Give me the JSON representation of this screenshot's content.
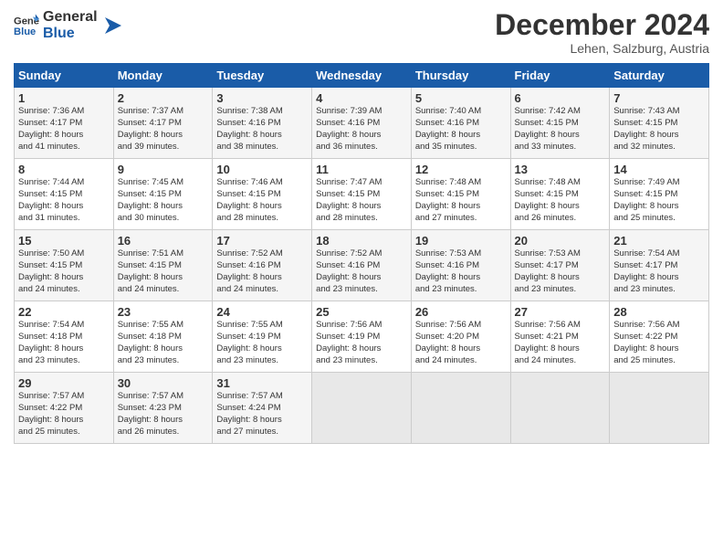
{
  "header": {
    "logo_line1": "General",
    "logo_line2": "Blue",
    "month": "December 2024",
    "location": "Lehen, Salzburg, Austria"
  },
  "columns": [
    "Sunday",
    "Monday",
    "Tuesday",
    "Wednesday",
    "Thursday",
    "Friday",
    "Saturday"
  ],
  "weeks": [
    [
      {
        "day": "1",
        "lines": [
          "Sunrise: 7:36 AM",
          "Sunset: 4:17 PM",
          "Daylight: 8 hours",
          "and 41 minutes."
        ]
      },
      {
        "day": "2",
        "lines": [
          "Sunrise: 7:37 AM",
          "Sunset: 4:17 PM",
          "Daylight: 8 hours",
          "and 39 minutes."
        ]
      },
      {
        "day": "3",
        "lines": [
          "Sunrise: 7:38 AM",
          "Sunset: 4:16 PM",
          "Daylight: 8 hours",
          "and 38 minutes."
        ]
      },
      {
        "day": "4",
        "lines": [
          "Sunrise: 7:39 AM",
          "Sunset: 4:16 PM",
          "Daylight: 8 hours",
          "and 36 minutes."
        ]
      },
      {
        "day": "5",
        "lines": [
          "Sunrise: 7:40 AM",
          "Sunset: 4:16 PM",
          "Daylight: 8 hours",
          "and 35 minutes."
        ]
      },
      {
        "day": "6",
        "lines": [
          "Sunrise: 7:42 AM",
          "Sunset: 4:15 PM",
          "Daylight: 8 hours",
          "and 33 minutes."
        ]
      },
      {
        "day": "7",
        "lines": [
          "Sunrise: 7:43 AM",
          "Sunset: 4:15 PM",
          "Daylight: 8 hours",
          "and 32 minutes."
        ]
      }
    ],
    [
      {
        "day": "8",
        "lines": [
          "Sunrise: 7:44 AM",
          "Sunset: 4:15 PM",
          "Daylight: 8 hours",
          "and 31 minutes."
        ]
      },
      {
        "day": "9",
        "lines": [
          "Sunrise: 7:45 AM",
          "Sunset: 4:15 PM",
          "Daylight: 8 hours",
          "and 30 minutes."
        ]
      },
      {
        "day": "10",
        "lines": [
          "Sunrise: 7:46 AM",
          "Sunset: 4:15 PM",
          "Daylight: 8 hours",
          "and 28 minutes."
        ]
      },
      {
        "day": "11",
        "lines": [
          "Sunrise: 7:47 AM",
          "Sunset: 4:15 PM",
          "Daylight: 8 hours",
          "and 28 minutes."
        ]
      },
      {
        "day": "12",
        "lines": [
          "Sunrise: 7:48 AM",
          "Sunset: 4:15 PM",
          "Daylight: 8 hours",
          "and 27 minutes."
        ]
      },
      {
        "day": "13",
        "lines": [
          "Sunrise: 7:48 AM",
          "Sunset: 4:15 PM",
          "Daylight: 8 hours",
          "and 26 minutes."
        ]
      },
      {
        "day": "14",
        "lines": [
          "Sunrise: 7:49 AM",
          "Sunset: 4:15 PM",
          "Daylight: 8 hours",
          "and 25 minutes."
        ]
      }
    ],
    [
      {
        "day": "15",
        "lines": [
          "Sunrise: 7:50 AM",
          "Sunset: 4:15 PM",
          "Daylight: 8 hours",
          "and 24 minutes."
        ]
      },
      {
        "day": "16",
        "lines": [
          "Sunrise: 7:51 AM",
          "Sunset: 4:15 PM",
          "Daylight: 8 hours",
          "and 24 minutes."
        ]
      },
      {
        "day": "17",
        "lines": [
          "Sunrise: 7:52 AM",
          "Sunset: 4:16 PM",
          "Daylight: 8 hours",
          "and 24 minutes."
        ]
      },
      {
        "day": "18",
        "lines": [
          "Sunrise: 7:52 AM",
          "Sunset: 4:16 PM",
          "Daylight: 8 hours",
          "and 23 minutes."
        ]
      },
      {
        "day": "19",
        "lines": [
          "Sunrise: 7:53 AM",
          "Sunset: 4:16 PM",
          "Daylight: 8 hours",
          "and 23 minutes."
        ]
      },
      {
        "day": "20",
        "lines": [
          "Sunrise: 7:53 AM",
          "Sunset: 4:17 PM",
          "Daylight: 8 hours",
          "and 23 minutes."
        ]
      },
      {
        "day": "21",
        "lines": [
          "Sunrise: 7:54 AM",
          "Sunset: 4:17 PM",
          "Daylight: 8 hours",
          "and 23 minutes."
        ]
      }
    ],
    [
      {
        "day": "22",
        "lines": [
          "Sunrise: 7:54 AM",
          "Sunset: 4:18 PM",
          "Daylight: 8 hours",
          "and 23 minutes."
        ]
      },
      {
        "day": "23",
        "lines": [
          "Sunrise: 7:55 AM",
          "Sunset: 4:18 PM",
          "Daylight: 8 hours",
          "and 23 minutes."
        ]
      },
      {
        "day": "24",
        "lines": [
          "Sunrise: 7:55 AM",
          "Sunset: 4:19 PM",
          "Daylight: 8 hours",
          "and 23 minutes."
        ]
      },
      {
        "day": "25",
        "lines": [
          "Sunrise: 7:56 AM",
          "Sunset: 4:19 PM",
          "Daylight: 8 hours",
          "and 23 minutes."
        ]
      },
      {
        "day": "26",
        "lines": [
          "Sunrise: 7:56 AM",
          "Sunset: 4:20 PM",
          "Daylight: 8 hours",
          "and 24 minutes."
        ]
      },
      {
        "day": "27",
        "lines": [
          "Sunrise: 7:56 AM",
          "Sunset: 4:21 PM",
          "Daylight: 8 hours",
          "and 24 minutes."
        ]
      },
      {
        "day": "28",
        "lines": [
          "Sunrise: 7:56 AM",
          "Sunset: 4:22 PM",
          "Daylight: 8 hours",
          "and 25 minutes."
        ]
      }
    ],
    [
      {
        "day": "29",
        "lines": [
          "Sunrise: 7:57 AM",
          "Sunset: 4:22 PM",
          "Daylight: 8 hours",
          "and 25 minutes."
        ]
      },
      {
        "day": "30",
        "lines": [
          "Sunrise: 7:57 AM",
          "Sunset: 4:23 PM",
          "Daylight: 8 hours",
          "and 26 minutes."
        ]
      },
      {
        "day": "31",
        "lines": [
          "Sunrise: 7:57 AM",
          "Sunset: 4:24 PM",
          "Daylight: 8 hours",
          "and 27 minutes."
        ]
      },
      null,
      null,
      null,
      null
    ]
  ]
}
